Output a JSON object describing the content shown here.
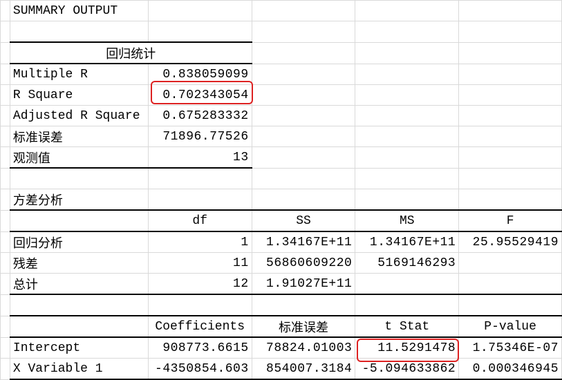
{
  "title": "SUMMARY OUTPUT",
  "regression_stats": {
    "header": "回归统计",
    "rows": [
      {
        "label": "Multiple R",
        "value": "0.838059099"
      },
      {
        "label": "R Square",
        "value": "0.702343054"
      },
      {
        "label": "Adjusted R Square",
        "value": "0.675283332"
      },
      {
        "label": "标准误差",
        "value": "71896.77526"
      },
      {
        "label": "观测值",
        "value": "13"
      }
    ]
  },
  "anova": {
    "title": "方差分析",
    "headers": {
      "df": "df",
      "ss": "SS",
      "ms": "MS",
      "f": "F"
    },
    "rows": [
      {
        "label": "回归分析",
        "df": "1",
        "ss": "1.34167E+11",
        "ms": "1.34167E+11",
        "f": "25.95529419"
      },
      {
        "label": "残差",
        "df": "11",
        "ss": "56860609220",
        "ms": "5169146293",
        "f": ""
      },
      {
        "label": "总计",
        "df": "12",
        "ss": "1.91027E+11",
        "ms": "",
        "f": ""
      }
    ]
  },
  "coef": {
    "headers": {
      "coef": "Coefficients",
      "se": "标准误差",
      "t": "t Stat",
      "p": "P-value"
    },
    "rows": [
      {
        "label": "Intercept",
        "coef": "908773.6615",
        "se": "78824.01003",
        "t": "11.5291478",
        "p": "1.75346E-07"
      },
      {
        "label": "X Variable 1",
        "coef": "-4350854.603",
        "se": "854007.3184",
        "t": "-5.094633862",
        "p": "0.000346945"
      }
    ]
  }
}
